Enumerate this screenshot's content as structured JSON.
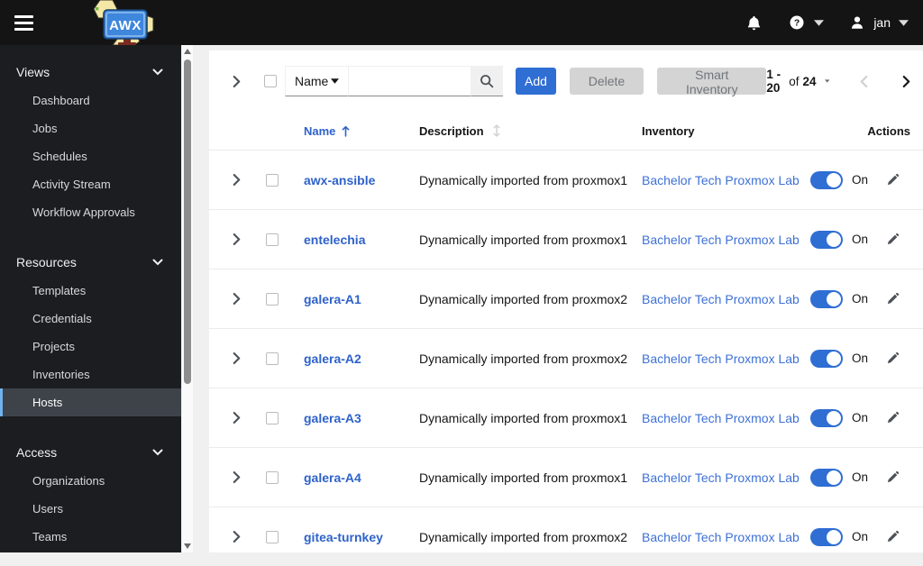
{
  "masthead": {
    "logo_text": "AWX",
    "user_name": "jan"
  },
  "sidebar": {
    "sections": [
      {
        "label": "Views",
        "items": [
          {
            "label": "Dashboard"
          },
          {
            "label": "Jobs"
          },
          {
            "label": "Schedules"
          },
          {
            "label": "Activity Stream"
          },
          {
            "label": "Workflow Approvals"
          }
        ]
      },
      {
        "label": "Resources",
        "items": [
          {
            "label": "Templates"
          },
          {
            "label": "Credentials"
          },
          {
            "label": "Projects"
          },
          {
            "label": "Inventories"
          },
          {
            "label": "Hosts",
            "active": true
          }
        ]
      },
      {
        "label": "Access",
        "items": [
          {
            "label": "Organizations"
          },
          {
            "label": "Users"
          },
          {
            "label": "Teams"
          }
        ]
      }
    ]
  },
  "toolbar": {
    "filter_selected": "Name",
    "search_value": "",
    "add_label": "Add",
    "delete_label": "Delete",
    "smart_inventory_label": "Smart Inventory",
    "pagination": {
      "range": "1 - 20",
      "of": "of",
      "total": "24"
    }
  },
  "table": {
    "headers": {
      "name": "Name",
      "description": "Description",
      "inventory": "Inventory",
      "actions": "Actions"
    },
    "rows": [
      {
        "name": "awx-ansible",
        "description": "Dynamically imported from proxmox1",
        "inventory": "Bachelor Tech Proxmox Lab",
        "state": "On"
      },
      {
        "name": "entelechia",
        "description": "Dynamically imported from proxmox1",
        "inventory": "Bachelor Tech Proxmox Lab",
        "state": "On"
      },
      {
        "name": "galera-A1",
        "description": "Dynamically imported from proxmox2",
        "inventory": "Bachelor Tech Proxmox Lab",
        "state": "On"
      },
      {
        "name": "galera-A2",
        "description": "Dynamically imported from proxmox2",
        "inventory": "Bachelor Tech Proxmox Lab",
        "state": "On"
      },
      {
        "name": "galera-A3",
        "description": "Dynamically imported from proxmox1",
        "inventory": "Bachelor Tech Proxmox Lab",
        "state": "On"
      },
      {
        "name": "galera-A4",
        "description": "Dynamically imported from proxmox1",
        "inventory": "Bachelor Tech Proxmox Lab",
        "state": "On"
      },
      {
        "name": "gitea-turnkey",
        "description": "Dynamically imported from proxmox2",
        "inventory": "Bachelor Tech Proxmox Lab",
        "state": "On"
      }
    ]
  },
  "colors": {
    "masthead_bg": "#141414",
    "sidebar_bg": "#1b1d21",
    "selected_item_bg": "#3e434a",
    "selected_item_border": "#6fb3f0",
    "accent_blue": "#2f6ed3",
    "link_blue": "#2e62c9",
    "inventory_link_blue": "#3e71d6",
    "toggle_on": "#2f6ed3",
    "disabled_button_bg": "#d4d4d4"
  }
}
